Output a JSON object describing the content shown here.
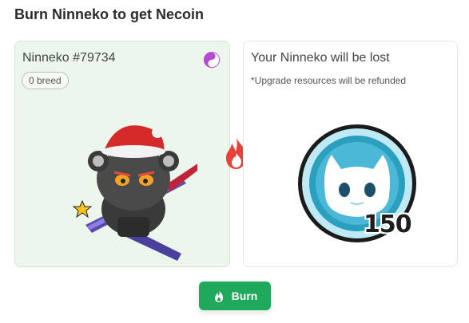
{
  "page": {
    "title": "Burn Ninneko to get Necoin"
  },
  "ninneko_card": {
    "name": "Ninneko #79734",
    "breed_badge": "0 breed",
    "class_icon": "yin-yang-icon"
  },
  "reward_card": {
    "title": "Your Ninneko will be lost",
    "note": "*Upgrade resources will be refunded",
    "coin_icon": "necoin-cat-coin-icon",
    "amount": "150"
  },
  "divider_icon": "fire-icon",
  "burn_button": {
    "label": "Burn",
    "icon": "fire-icon",
    "color": "#1fa95a"
  },
  "colors": {
    "left_card_bg": "#ecf6ec",
    "fire": "#e8413a",
    "coin_blue": "#2a9fbe"
  }
}
